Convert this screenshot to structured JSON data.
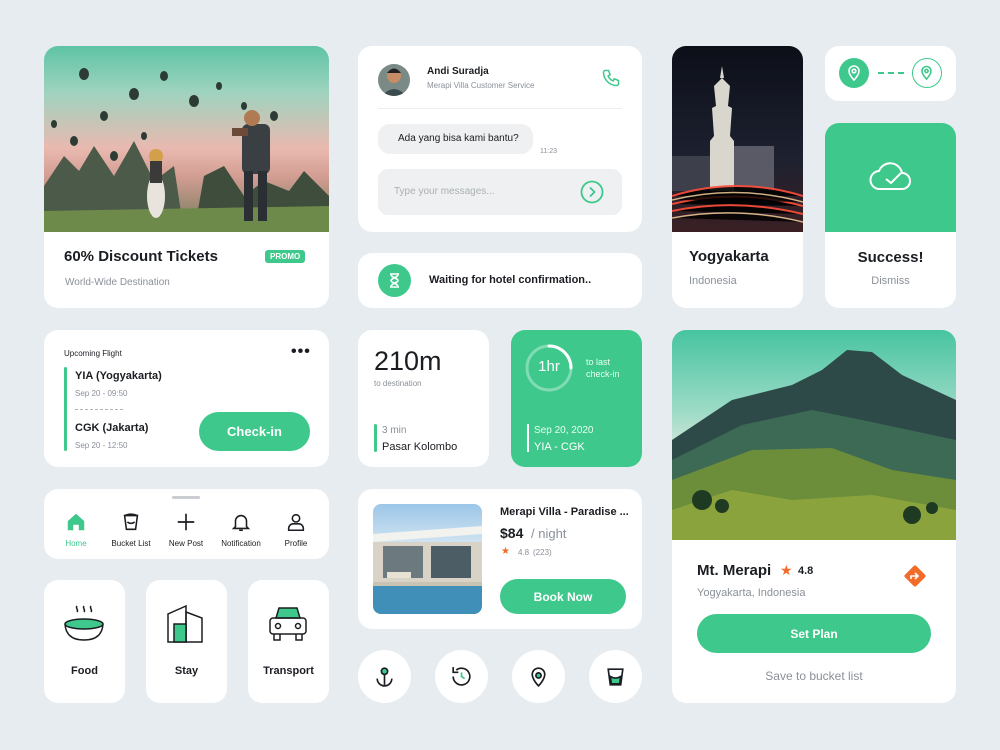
{
  "colors": {
    "accent": "#3ec88c",
    "background": "#e6ecef",
    "rating_star": "#f26b2a"
  },
  "promo_card": {
    "title": "60% Discount Tickets",
    "badge": "PROMO",
    "subtitle": "World-Wide Destination"
  },
  "chat": {
    "agent_name": "Andi Suradja",
    "agent_role": "Merapi Villa Customer Service",
    "message": "Ada yang bisa kami bantu?",
    "message_time": "11:23",
    "input_placeholder": "Type your messages..."
  },
  "hotel_wait": {
    "text": "Waiting for hotel confirmation.."
  },
  "city": {
    "name": "Yogyakarta",
    "country": "Indonesia"
  },
  "success": {
    "title": "Success!",
    "dismiss": "Dismiss"
  },
  "flight": {
    "header": "Upcoming Flight",
    "from_code": "YIA (Yogyakarta)",
    "from_time": "Sep 20 - 09:50",
    "to_code": "CGK (Jakarta)",
    "to_time": "Sep 20 - 12:50",
    "checkin_label": "Check-in"
  },
  "distance": {
    "value": "210m",
    "label": "to destination",
    "walk_time": "3 min",
    "stop": "Pasar Kolombo"
  },
  "timer": {
    "value": "1hr",
    "label": "to last check-in",
    "progress": 0.25,
    "date": "Sep 20, 2020",
    "route": "YIA - CGK"
  },
  "mountain": {
    "name": "Mt. Merapi",
    "rating": "4.8",
    "location": "Yogyakarta, Indonesia",
    "set_plan": "Set Plan",
    "save_bucket": "Save to bucket list"
  },
  "nav": {
    "items": [
      {
        "label": "Home",
        "icon": "home-icon",
        "active": true
      },
      {
        "label": "Bucket List",
        "icon": "bucket-icon"
      },
      {
        "label": "New Post",
        "icon": "plus-icon"
      },
      {
        "label": "Notification",
        "icon": "bell-icon"
      },
      {
        "label": "Profile",
        "icon": "user-icon"
      }
    ]
  },
  "villa": {
    "name": "Merapi Villa - Paradise ...",
    "price": "$84",
    "per": "/ night",
    "rating": "4.8",
    "reviews": "(223)",
    "book_label": "Book Now"
  },
  "categories": [
    {
      "label": "Food",
      "icon": "food-bowl-icon"
    },
    {
      "label": "Stay",
      "icon": "building-icon"
    },
    {
      "label": "Transport",
      "icon": "car-icon"
    }
  ],
  "action_icons": [
    "anchor-pin-icon",
    "history-icon",
    "location-pin-icon",
    "bucket-icon"
  ]
}
